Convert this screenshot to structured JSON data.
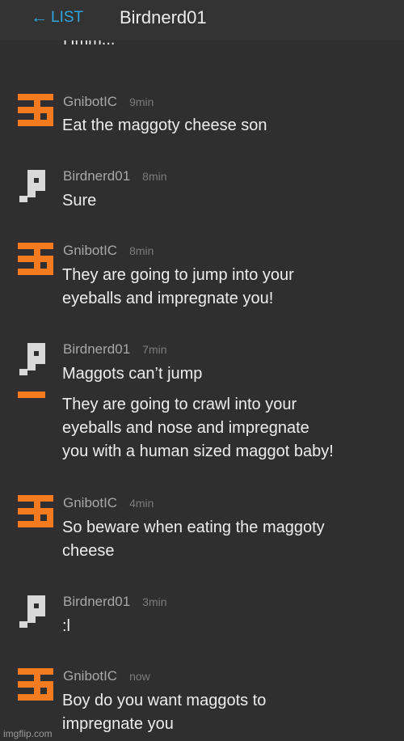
{
  "header": {
    "back_arrow": "←",
    "back_label": "LIST",
    "title": "Birdnerd01"
  },
  "cutoff_text": "Hmm...",
  "messages": [
    {
      "user": "GnibotIC",
      "time": "9min",
      "avatar": "orange-g-pixel-icon",
      "lines": [
        "Eat the maggoty cheese son"
      ]
    },
    {
      "user": "Birdnerd01",
      "time": "8min",
      "avatar": "gray-pixel-bird-icon",
      "lines": [
        "Sure"
      ]
    },
    {
      "user": "GnibotIC",
      "time": "8min",
      "avatar": "orange-g-pixel-icon",
      "lines": [
        "They are going to jump into your",
        "eyeballs and impregnate you!"
      ]
    },
    {
      "user": "Birdnerd01",
      "time": "7min",
      "avatar": "gray-pixel-bird-icon",
      "lines": [
        "Maggots can’t jump"
      ]
    },
    {
      "avatar": "orange-dash-icon",
      "lines": [
        "They are going to crawl into your",
        "eyeballs and nose and impregnate",
        "you with a human sized maggot baby!"
      ]
    },
    {
      "user": "GnibotIC",
      "time": "4min",
      "avatar": "orange-g-pixel-icon",
      "lines": [
        "So beware when eating the maggoty",
        "cheese"
      ]
    },
    {
      "user": "Birdnerd01",
      "time": "3min",
      "avatar": "gray-pixel-bird-icon",
      "lines": [
        ":l"
      ]
    },
    {
      "user": "GnibotIC",
      "time": "now",
      "avatar": "orange-g-pixel-icon",
      "lines": [
        "Boy do you want maggots to",
        "impregnate you"
      ]
    }
  ],
  "watermark": "imgflip.com",
  "colors": {
    "accent": "#2fa6dd",
    "orange": "#f47b20",
    "background": "#2f2f2f"
  }
}
